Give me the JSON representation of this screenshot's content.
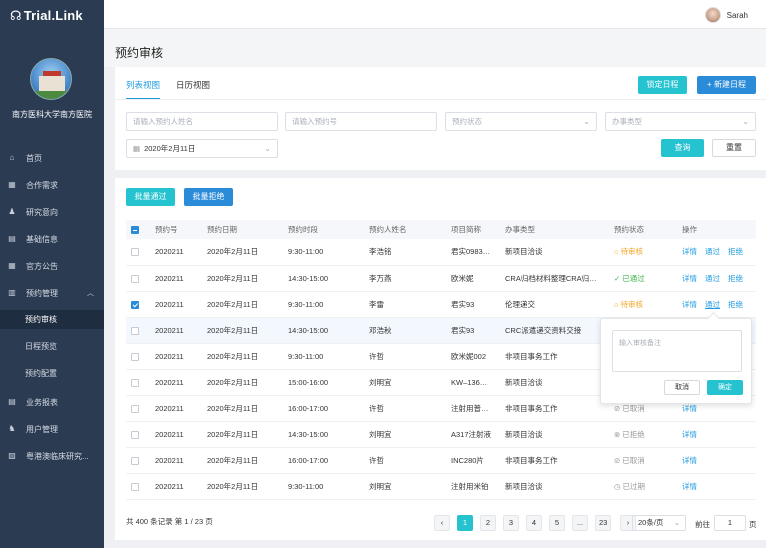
{
  "brand": {
    "logo_mark": "☊",
    "logo_text": "Trial.Link"
  },
  "hospital": {
    "name": "南方医科大学南方医院"
  },
  "nav": {
    "items": [
      {
        "label": "首页",
        "icon": "home-icon",
        "glyph": "⌂"
      },
      {
        "label": "合作需求",
        "icon": "grid-icon",
        "glyph": "▦"
      },
      {
        "label": "研究意向",
        "icon": "person-icon",
        "glyph": "♟"
      },
      {
        "label": "基础信息",
        "icon": "card-icon",
        "glyph": "▤"
      },
      {
        "label": "官方公告",
        "icon": "calendar-icon",
        "glyph": "▦"
      },
      {
        "label": "预约管理",
        "icon": "calendar-check-icon",
        "glyph": "▥",
        "chev": "︿"
      },
      {
        "label": "预约审核",
        "sub": true,
        "active": true
      },
      {
        "label": "日程预览",
        "sub": true
      },
      {
        "label": "预约配置",
        "sub": true
      },
      {
        "label": "业务报表",
        "icon": "report-icon",
        "glyph": "▤"
      },
      {
        "label": "用户管理",
        "icon": "users-icon",
        "glyph": "♞"
      },
      {
        "label": "粤港澳临床研究...",
        "icon": "image-icon",
        "glyph": "▨"
      }
    ]
  },
  "user": {
    "name": "Sarah"
  },
  "page": {
    "title": "预约审核"
  },
  "tabs": [
    "列表视图",
    "日历视图"
  ],
  "buttons": {
    "lock_schedule": "锁定日程",
    "new_schedule": "+ 新建日程",
    "query": "查询",
    "reset": "重置",
    "batch_pass": "批量通过",
    "batch_reject": "批量拒绝"
  },
  "filters": {
    "name_placeholder": "请输入预约人姓名",
    "id_placeholder": "请输入预约号",
    "status_placeholder": "预约状态",
    "type_placeholder": "办事类型",
    "date_value": "2020年2月11日"
  },
  "table": {
    "headers": [
      "预约号",
      "预约日期",
      "预约时段",
      "预约人姓名",
      "项目简称",
      "办事类型",
      "预约状态",
      "操作"
    ],
    "rows": [
      {
        "id": "2020211",
        "date": "2020年2月11日",
        "time": "9:30-11:00",
        "name": "李浩铭",
        "project": "君实0983…",
        "type": "新项目洽谈",
        "status": "待审核",
        "status_icon": "⌂",
        "kind": "pend",
        "actions": [
          "详情",
          "通过",
          "拒绝"
        ]
      },
      {
        "id": "2020211",
        "date": "2020年2月11日",
        "time": "14:30-15:00",
        "name": "李万燕",
        "project": "欧米妮",
        "type": "CRA归档材料整理CRA归…",
        "status": "已通过",
        "status_icon": "✓",
        "kind": "ok",
        "actions": [
          "详情",
          "通过",
          "拒绝"
        ]
      },
      {
        "id": "2020211",
        "date": "2020年2月11日",
        "time": "9:30-11:00",
        "name": "李雷",
        "project": "君实93",
        "type": "伦理递交",
        "status": "待审核",
        "status_icon": "⌂",
        "kind": "pend",
        "actions": [
          "详情",
          "通过",
          "拒绝"
        ],
        "checked": true
      },
      {
        "id": "2020211",
        "date": "2020年2月11日",
        "time": "14:30-15:00",
        "name": "邓浩秋",
        "project": "君实93",
        "type": "CRC派遣递交资料交接",
        "status": "",
        "status_icon": "",
        "kind": "none",
        "actions": []
      },
      {
        "id": "2020211",
        "date": "2020年2月11日",
        "time": "9:30-11:00",
        "name": "许哲",
        "project": "欧米妮002",
        "type": "非项目事务工作",
        "status": "",
        "status_icon": "",
        "kind": "none",
        "actions": []
      },
      {
        "id": "2020211",
        "date": "2020年2月11日",
        "time": "15:00-16:00",
        "name": "刘明宜",
        "project": "KW–136…",
        "type": "新项目洽谈",
        "status": "",
        "status_icon": "",
        "kind": "none",
        "actions": []
      },
      {
        "id": "2020211",
        "date": "2020年2月11日",
        "time": "16:00-17:00",
        "name": "许哲",
        "project": "注射用普…",
        "type": "非项目事务工作",
        "status": "已取消",
        "status_icon": "⊘",
        "kind": "gray",
        "actions": [
          "详情"
        ]
      },
      {
        "id": "2020211",
        "date": "2020年2月11日",
        "time": "14:30-15:00",
        "name": "刘明宜",
        "project": "A317注射液",
        "type": "新项目洽谈",
        "status": "已拒绝",
        "status_icon": "⊗",
        "kind": "gray",
        "actions": [
          "详情"
        ]
      },
      {
        "id": "2020211",
        "date": "2020年2月11日",
        "time": "16:00-17:00",
        "name": "许哲",
        "project": "INC280片",
        "type": "非项目事务工作",
        "status": "已取消",
        "status_icon": "⊘",
        "kind": "gray",
        "actions": [
          "详情"
        ]
      },
      {
        "id": "2020211",
        "date": "2020年2月11日",
        "time": "9:30-11:00",
        "name": "刘明宜",
        "project": "注射用米铂",
        "type": "新项目洽谈",
        "status": "已过期",
        "status_icon": "◷",
        "kind": "gray",
        "actions": [
          "详情"
        ]
      }
    ]
  },
  "popup": {
    "placeholder": "输入审核备注",
    "cancel": "取消",
    "confirm": "确定"
  },
  "pagination": {
    "summary": "共 400 条记录 第 1 / 23 页",
    "prev": "‹",
    "pages": [
      "1",
      "2",
      "3",
      "4",
      "5",
      "...",
      "23"
    ],
    "next": "›",
    "page_size": "20条/页",
    "goto_label": "前往",
    "goto_value": "1",
    "page_suffix": "页"
  },
  "colors": {
    "sidebar": "#2b3b52",
    "accent": "#25c2cf",
    "primary": "#2a8bd9",
    "link": "#1e9be0"
  }
}
